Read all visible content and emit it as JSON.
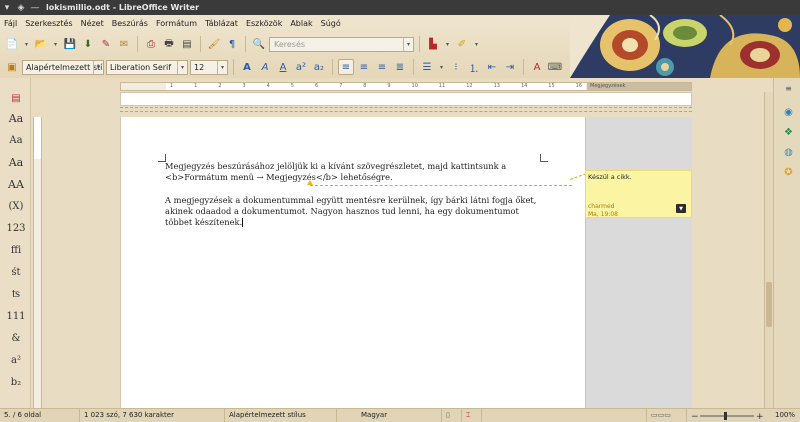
{
  "window": {
    "title": "lokismillio.odt - LibreOffice Writer",
    "controls": [
      "▾",
      "◈",
      "—"
    ]
  },
  "menu": [
    "Fájl",
    "Szerkesztés",
    "Nézet",
    "Beszúrás",
    "Formátum",
    "Táblázat",
    "Eszközök",
    "Ablak",
    "Súgó"
  ],
  "toolbar": {
    "search_placeholder": "Keresés",
    "paragraph_style": "Alapértelmezett stí",
    "font_name": "Liberation Serif",
    "font_size": "12"
  },
  "sidebar_left": {
    "chars": [
      "Aa",
      "Aa",
      "Aa",
      "AA",
      "(X)",
      "123",
      "ffi",
      "śt",
      "ʦ",
      "111",
      "&",
      "a²",
      "b₂"
    ]
  },
  "ruler": {
    "comment_label": "Megjegyzések",
    "numbers": [
      "1",
      "2",
      "1",
      "1",
      "2",
      "3",
      "4",
      "5",
      "6",
      "7",
      "8",
      "9",
      "10",
      "11",
      "12",
      "13",
      "14",
      "15",
      "16"
    ]
  },
  "document": {
    "paragraph1": "Megjegyzés beszúrásához jelöljük ki a kívánt szövegrészletet, majd kattintsunk a <b>Formátum menü → Megjegyzés</b> lehetőségre.",
    "paragraph2": "A megjegyzések a dokumentummal együtt mentésre kerülnek, így bárki látni fogja őket, akinek odaadod a dokumentumot. Nagyon hasznos tud lenni, ha egy dokumentumot többet készítenek."
  },
  "comment": {
    "text": "Készül a cikk.",
    "author": "charmed",
    "time": "Ma, 19:08"
  },
  "statusbar": {
    "page": "5. / 6 oldal",
    "words": "1 023 szó, 7 630 karakter",
    "style": "Alapértelmezett stílus",
    "language": "Magyar",
    "zoom": "100%"
  },
  "colors": {
    "accent": "#f0b800",
    "comment_bg": "#fbf5a3",
    "ui_bg": "#e9dcc0"
  }
}
